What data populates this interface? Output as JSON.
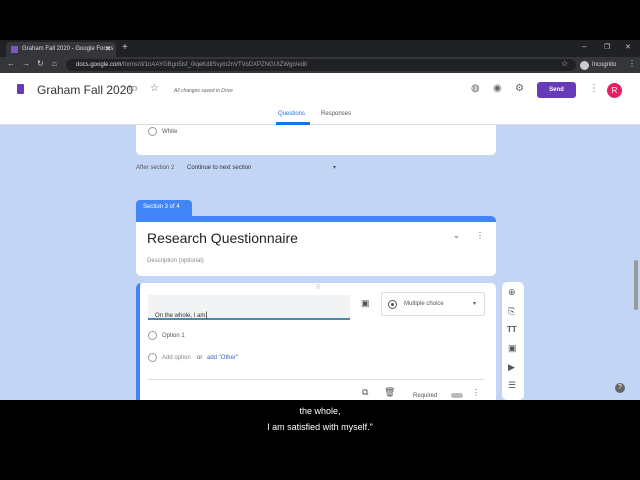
{
  "browser": {
    "tab_title": "Graham Fall 2020 - Google Forms",
    "url_domain": "docs.google.com",
    "url_path": "/forms/d/1nAAYGBgn5lsf_0iqeKdllSsym2nVTVoDXPZNGUIZWgo/edit",
    "incognito_label": "Incognito"
  },
  "header": {
    "title": "Graham Fall 2020",
    "saved_status": "All changes saved in Drive",
    "send_label": "Send",
    "avatar_initial": "R",
    "tabs": [
      {
        "label": "Questions",
        "active": true
      },
      {
        "label": "Responses",
        "active": false
      }
    ]
  },
  "prev_section": {
    "option": "White",
    "after_label": "After section 2",
    "after_value": "Continue to next section"
  },
  "section": {
    "badge": "Section 3 of 4",
    "title": "Research Questionnaire",
    "description_placeholder": "Description (optional)"
  },
  "question": {
    "text": "On the whole, I am",
    "type": "Multiple choice",
    "option1": "Option 1",
    "add_option": "Add option",
    "or": "or",
    "add_other": "add \"Other\"",
    "required_label": "Required"
  },
  "subtitles": {
    "line1": "the whole,",
    "line2": "I am satisfied with myself.\""
  },
  "colors": {
    "accent": "#673ab7",
    "blue": "#4285f4",
    "background": "#c3d5f5"
  }
}
